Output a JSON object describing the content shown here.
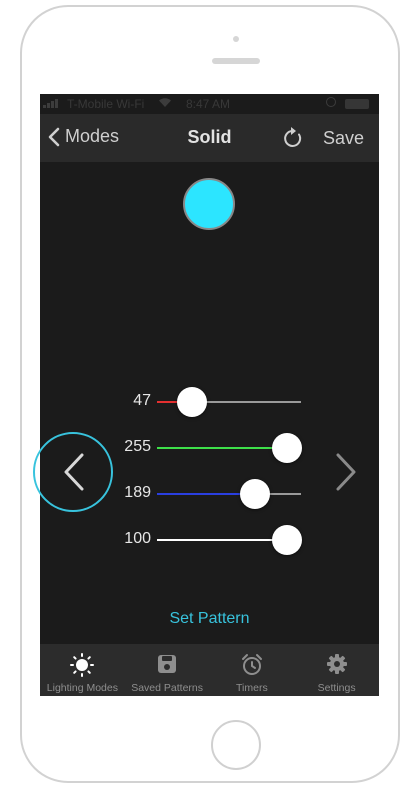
{
  "status_bar": {
    "carrier": "T-Mobile Wi-Fi",
    "time": "8:47 AM"
  },
  "nav": {
    "back_label": "Modes",
    "title": "Solid",
    "save_label": "Save"
  },
  "preview": {
    "color": "#2ce5ff"
  },
  "sliders": [
    {
      "id": "red",
      "value": "47",
      "fraction": 0.24,
      "color": "#e53030"
    },
    {
      "id": "green",
      "value": "255",
      "fraction": 0.9,
      "color": "#3ee04a"
    },
    {
      "id": "blue",
      "value": "189",
      "fraction": 0.68,
      "color": "#2a3fe0"
    },
    {
      "id": "brightness",
      "value": "100",
      "fraction": 0.9,
      "color": "#ffffff"
    }
  ],
  "actions": {
    "set_pattern": "Set Pattern"
  },
  "accent_color": "#38c3dd",
  "tabs": [
    {
      "label": "Lighting Modes",
      "icon": "sun-icon",
      "active": true
    },
    {
      "label": "Saved Patterns",
      "icon": "save-icon",
      "active": false
    },
    {
      "label": "Timers",
      "icon": "alarm-clock-icon",
      "active": false
    },
    {
      "label": "Settings",
      "icon": "gear-icon",
      "active": false
    }
  ]
}
